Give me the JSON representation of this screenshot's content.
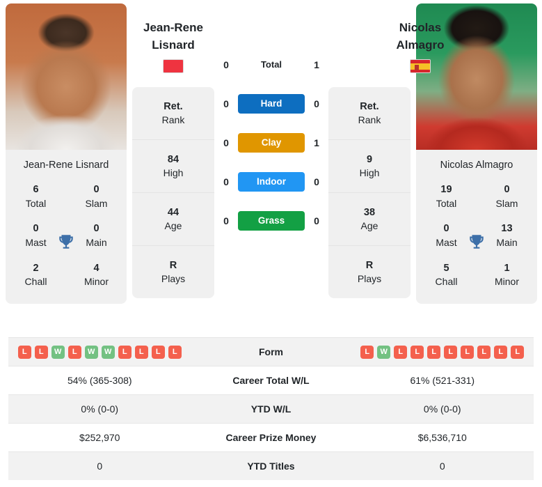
{
  "players": {
    "left": {
      "first_name": "Jean-Rene",
      "last_name": "Lisnard",
      "full_name": "Jean-Rene Lisnard",
      "flag": "monaco-flag",
      "titles": {
        "total": "6",
        "total_label": "Total",
        "slam": "0",
        "slam_label": "Slam",
        "mast": "0",
        "mast_label": "Mast",
        "main": "0",
        "main_label": "Main",
        "chall": "2",
        "chall_label": "Chall",
        "minor": "4",
        "minor_label": "Minor"
      },
      "stats": [
        {
          "value": "Ret.",
          "label": "Rank"
        },
        {
          "value": "84",
          "label": "High"
        },
        {
          "value": "44",
          "label": "Age"
        },
        {
          "value": "R",
          "label": "Plays"
        }
      ],
      "form": [
        "L",
        "L",
        "W",
        "L",
        "W",
        "W",
        "L",
        "L",
        "L",
        "L"
      ],
      "career_total_wl": "54% (365-308)",
      "ytd_wl": "0% (0-0)",
      "career_prize_money": "$252,970",
      "ytd_titles": "0"
    },
    "right": {
      "first_name": "Nicolas",
      "last_name": "Almagro",
      "full_name": "Nicolas Almagro",
      "flag": "spain-flag",
      "titles": {
        "total": "19",
        "total_label": "Total",
        "slam": "0",
        "slam_label": "Slam",
        "mast": "0",
        "mast_label": "Mast",
        "main": "13",
        "main_label": "Main",
        "chall": "5",
        "chall_label": "Chall",
        "minor": "1",
        "minor_label": "Minor"
      },
      "stats": [
        {
          "value": "Ret.",
          "label": "Rank"
        },
        {
          "value": "9",
          "label": "High"
        },
        {
          "value": "38",
          "label": "Age"
        },
        {
          "value": "R",
          "label": "Plays"
        }
      ],
      "form": [
        "L",
        "W",
        "L",
        "L",
        "L",
        "L",
        "L",
        "L",
        "L",
        "L"
      ],
      "career_total_wl": "61% (521-331)",
      "ytd_wl": "0% (0-0)",
      "career_prize_money": "$6,536,710",
      "ytd_titles": "0"
    }
  },
  "head_to_head": {
    "total": {
      "label": "Total",
      "left": "0",
      "right": "1"
    },
    "surfaces": [
      {
        "label": "Hard",
        "left": "0",
        "right": "0",
        "color": "#0d6ec0"
      },
      {
        "label": "Clay",
        "left": "0",
        "right": "1",
        "color": "#e09600"
      },
      {
        "label": "Indoor",
        "left": "0",
        "right": "0",
        "color": "#2196f3"
      },
      {
        "label": "Grass",
        "left": "0",
        "right": "0",
        "color": "#13a044"
      }
    ]
  },
  "table_rows": [
    {
      "label": "Form",
      "key": "form",
      "type": "form"
    },
    {
      "label": "Career Total W/L",
      "key": "career_total_wl",
      "type": "text"
    },
    {
      "label": "YTD W/L",
      "key": "ytd_wl",
      "type": "text"
    },
    {
      "label": "Career Prize Money",
      "key": "career_prize_money",
      "type": "text"
    },
    {
      "label": "YTD Titles",
      "key": "ytd_titles",
      "type": "text"
    }
  ],
  "colors": {
    "badge_win": "#73c182",
    "badge_loss": "#f4604d",
    "trophy": "#3d6fa8",
    "panel": "#f0f0f0",
    "row_shade": "#f2f2f2"
  }
}
